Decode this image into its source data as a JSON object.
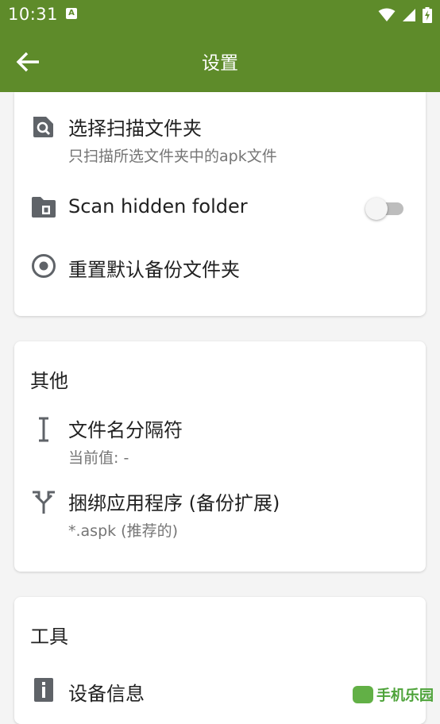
{
  "status_bar": {
    "time": "10:31",
    "notification_glyph": "A",
    "icons": [
      "wifi-icon",
      "cell-signal-icon",
      "battery-charging-icon"
    ]
  },
  "app_bar": {
    "title": "设置",
    "back_icon": "arrow-back-icon"
  },
  "scan_card": {
    "items": [
      {
        "icon": "folder-search-icon",
        "title": "选择扫描文件夹",
        "summary": "只扫描所选文件夹中的apk文件"
      },
      {
        "icon": "folder-icon",
        "title": "Scan hidden folder",
        "toggle_on": false
      },
      {
        "icon": "radio-target-icon",
        "title": "重置默认备份文件夹"
      }
    ]
  },
  "other_card": {
    "header": "其他",
    "items": [
      {
        "icon": "text-cursor-icon",
        "title": "文件名分隔符",
        "summary": "当前值: -"
      },
      {
        "icon": "merge-arrows-icon",
        "title": "捆绑应用程序 (备份扩展)",
        "summary": "*.aspk (推荐的)"
      }
    ]
  },
  "tools_card": {
    "header": "工具",
    "items": [
      {
        "icon": "info-icon",
        "title": "设备信息"
      }
    ]
  },
  "colors": {
    "primary": "#5e8b2a",
    "background": "#f4f4f4",
    "card": "#ffffff",
    "icon": "#5f6368"
  },
  "watermark": {
    "text": "手机乐园"
  }
}
